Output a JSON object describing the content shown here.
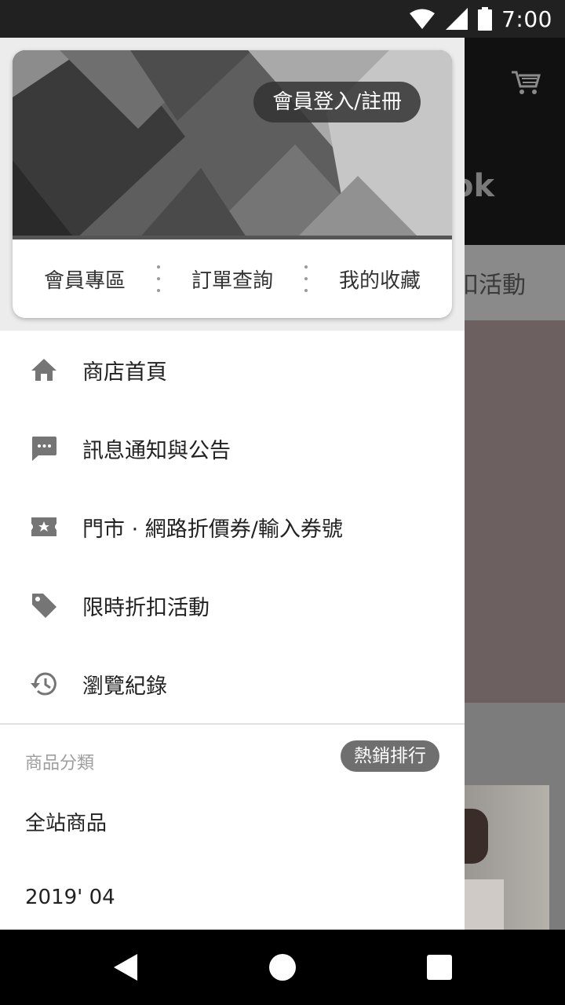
{
  "status_bar": {
    "time": "7:00"
  },
  "background": {
    "logo_text": "ok",
    "tab_text": "扣活動"
  },
  "drawer": {
    "login_button": "會員登入/註冊",
    "quick_links": [
      "會員專區",
      "訂單查詢",
      "我的收藏"
    ],
    "menu": [
      {
        "icon": "home-icon",
        "label": "商店首頁"
      },
      {
        "icon": "message-icon",
        "label": "訊息通知與公告"
      },
      {
        "icon": "coupon-icon",
        "label": "門市 · 網路折價券/輸入券號"
      },
      {
        "icon": "tag-icon",
        "label": "限時折扣活動"
      },
      {
        "icon": "history-icon",
        "label": "瀏覽紀錄"
      }
    ],
    "category_header": "商品分類",
    "hot_badge": "熱銷排行",
    "categories": [
      "全站商品",
      "2019' 04"
    ]
  }
}
